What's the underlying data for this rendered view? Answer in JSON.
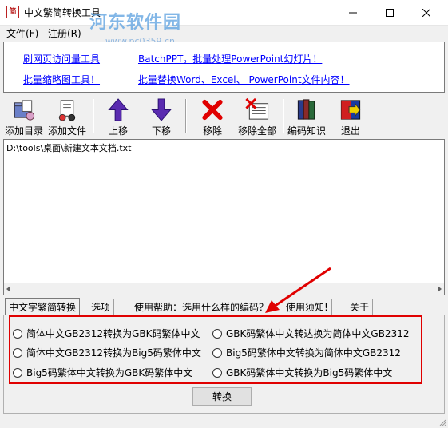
{
  "window": {
    "icon_text": "简",
    "title": "中文繁简转换工具",
    "watermark": "河东软件园",
    "watermark_url": "www.pc0359.cn"
  },
  "menu": {
    "file": "文件(F)",
    "register": "注册(R)"
  },
  "links": [
    "刷网页访问量工具",
    "BatchPPT，批量处理PowerPoint幻灯片！",
    "批量缩略图工具！",
    "批量替换Word、Excel、 PowerPoint文件内容！"
  ],
  "toolbar": {
    "add_dir": "添加目录",
    "add_file": "添加文件",
    "move_up": "上移",
    "move_down": "下移",
    "remove": "移除",
    "remove_all": "移除全部",
    "encoding_info": "编码知识",
    "exit": "退出"
  },
  "files": [
    "D:\\tools\\桌面\\新建文本文档.txt"
  ],
  "tabs": [
    "中文字繁简转换",
    "选项",
    "使用帮助：选用什么样的编码？",
    "使用须知!",
    "关于"
  ],
  "options": [
    "简体中文GB2312转换为GBK码繁体中文",
    "GBK码繁体中文转达换为简体中文GB2312",
    "简体中文GB2312转换为Big5码繁体中文",
    "Big5码繁体中文转换为简体中文GB2312",
    "Big5码繁体中文转换为GBK码繁体中文",
    "GBK码繁体中文转换为Big5码繁体中文"
  ],
  "convert_label": "转换",
  "colors": {
    "link": "#0000ff",
    "highlight": "#e00000",
    "arrow_up_down": "#5a2bb0",
    "remove_x": "#e00000"
  }
}
